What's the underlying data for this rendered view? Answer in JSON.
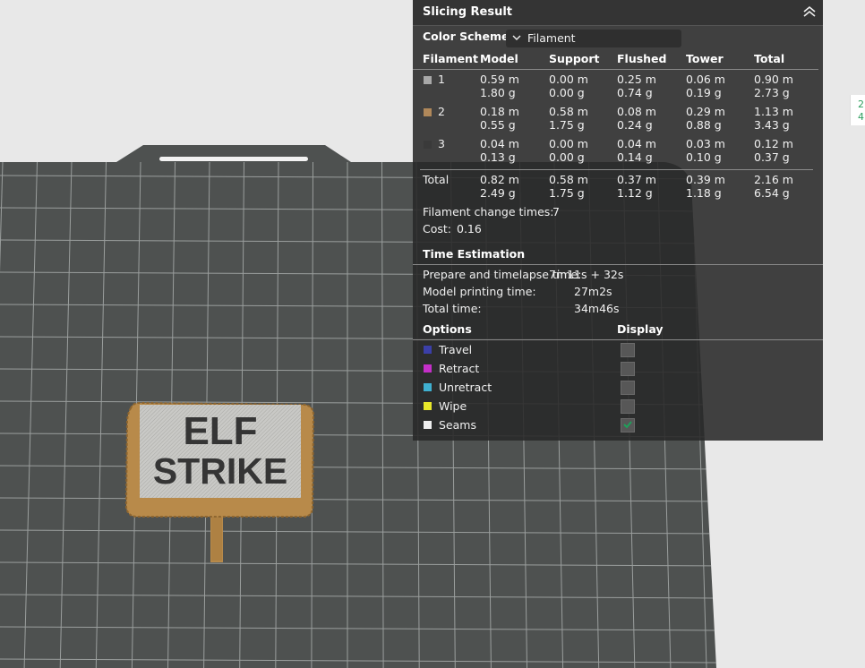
{
  "panel": {
    "title": "Slicing Result",
    "color_scheme_label": "Color Scheme",
    "color_scheme_value": "Filament",
    "columns": [
      "Filament",
      "Model",
      "Support",
      "Flushed",
      "Tower",
      "Total"
    ],
    "rows": [
      {
        "id": "1",
        "color": "#a8a8a8",
        "model": [
          "0.59 m",
          "1.80 g"
        ],
        "support": [
          "0.00 m",
          "0.00 g"
        ],
        "flushed": [
          "0.25 m",
          "0.74 g"
        ],
        "tower": [
          "0.06 m",
          "0.19 g"
        ],
        "total": [
          "0.90 m",
          "2.73 g"
        ]
      },
      {
        "id": "2",
        "color": "#b0885a",
        "model": [
          "0.18 m",
          "0.55 g"
        ],
        "support": [
          "0.58 m",
          "1.75 g"
        ],
        "flushed": [
          "0.08 m",
          "0.24 g"
        ],
        "tower": [
          "0.29 m",
          "0.88 g"
        ],
        "total": [
          "1.13 m",
          "3.43 g"
        ]
      },
      {
        "id": "3",
        "color": "#3a3a3a",
        "model": [
          "0.04 m",
          "0.13 g"
        ],
        "support": [
          "0.00 m",
          "0.00 g"
        ],
        "flushed": [
          "0.04 m",
          "0.14 g"
        ],
        "tower": [
          "0.03 m",
          "0.10 g"
        ],
        "total": [
          "0.12 m",
          "0.37 g"
        ]
      }
    ],
    "total_row": {
      "label": "Total",
      "model": [
        "0.82 m",
        "2.49 g"
      ],
      "support": [
        "0.58 m",
        "1.75 g"
      ],
      "flushed": [
        "0.37 m",
        "1.12 g"
      ],
      "tower": [
        "0.39 m",
        "1.18 g"
      ],
      "total": [
        "2.16 m",
        "6.54 g"
      ]
    },
    "filament_change_label": "Filament change times:",
    "filament_change_value": "7",
    "cost_label": "Cost:",
    "cost_value": "0.16",
    "time_heading": "Time Estimation",
    "prepare_label": "Prepare and timelapse time:",
    "prepare_value": "7m11s + 32s",
    "model_time_label": "Model printing time:",
    "model_time_value": "27m2s",
    "total_time_label": "Total time:",
    "total_time_value": "34m46s",
    "options_heading": "Options",
    "display_heading": "Display",
    "options": [
      {
        "label": "Travel",
        "color": "#3b3fa8",
        "checked": false
      },
      {
        "label": "Retract",
        "color": "#c42fc8",
        "checked": false
      },
      {
        "label": "Unretract",
        "color": "#3fb0d0",
        "checked": false
      },
      {
        "label": "Wipe",
        "color": "#e8e82a",
        "checked": false
      },
      {
        "label": "Seams",
        "color": "#eeeeee",
        "checked": true
      }
    ]
  },
  "model_text": {
    "line1": "ELF",
    "line2": "STRIKE"
  },
  "edge_text": {
    "line1": "2",
    "line2": "4"
  },
  "colors": {
    "accent_check": "#1ea05a",
    "plate": "#4e5150",
    "filament_gold": "#b88a4a"
  }
}
